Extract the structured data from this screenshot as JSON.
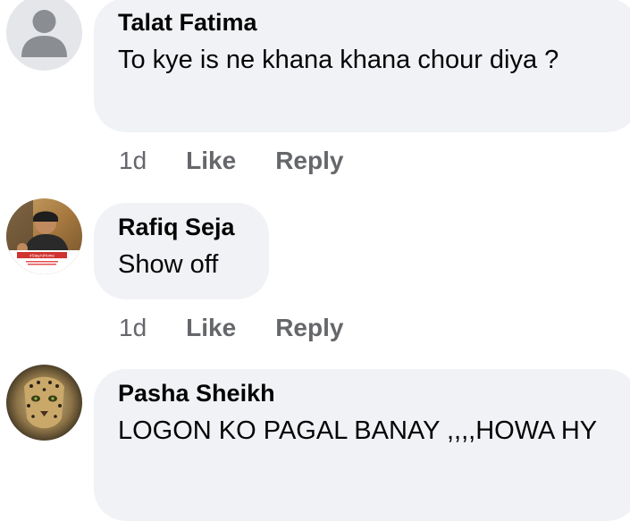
{
  "comments": [
    {
      "author": "Talat Fatima",
      "text": "To kye is ne khana khana chour diya ?",
      "time": "1d",
      "like_label": "Like",
      "reply_label": "Reply",
      "avatar_icon": "default-user-icon"
    },
    {
      "author": "Rafiq Seja",
      "text": "Show off",
      "time": "1d",
      "like_label": "Like",
      "reply_label": "Reply",
      "avatar_icon": "profile-photo",
      "avatar_badge": "#StayAtHome"
    },
    {
      "author": "Pasha Sheikh",
      "text": "LOGON KO PAGAL BANAY ,,,,HOWA HY",
      "avatar_icon": "leopard-photo"
    }
  ],
  "colors": {
    "bubble": "#f0f2f5",
    "meta_text": "#65676b",
    "primary_text": "#050505"
  }
}
